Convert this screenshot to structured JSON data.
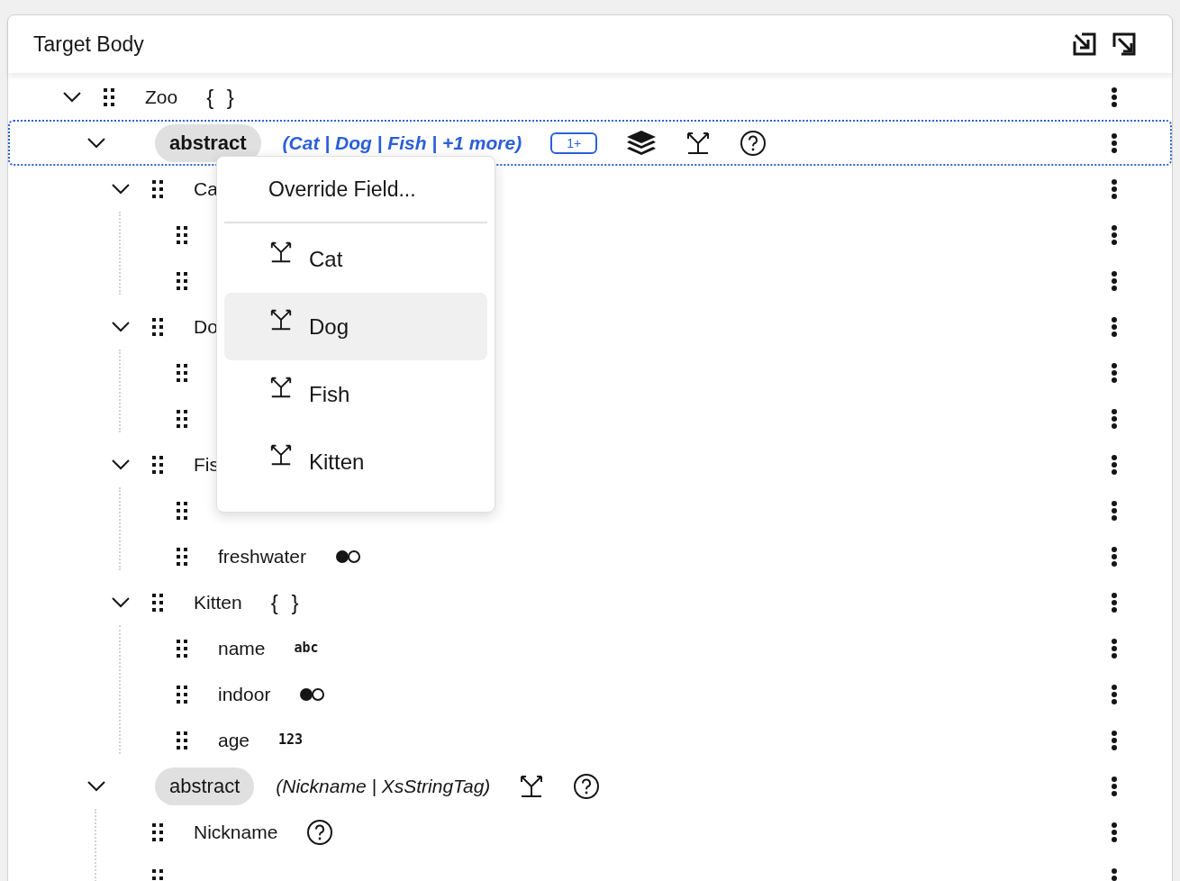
{
  "panel": {
    "title": "Target Body"
  },
  "tree": [
    {
      "kind": "object",
      "label": "Zoo",
      "type_badge": "{ }",
      "expanded": true,
      "children": [
        {
          "kind": "abstract",
          "label": "abstract",
          "types": "(Cat | Dog | Fish | +1 more)",
          "count_badge": "1+",
          "layers_button": true,
          "override_button": true,
          "help_button": true,
          "expanded": true,
          "selected": true,
          "children": [
            {
              "kind": "object",
              "label": "Ca",
              "expanded": true,
              "children": [
                {
                  "kind": "field"
                },
                {
                  "kind": "field"
                }
              ]
            },
            {
              "kind": "object",
              "label": "Do",
              "expanded": true,
              "children": [
                {
                  "kind": "field"
                },
                {
                  "kind": "field"
                }
              ]
            },
            {
              "kind": "object",
              "label": "Fis",
              "expanded": true,
              "children": [
                {
                  "kind": "field"
                },
                {
                  "kind": "boolean_field",
                  "label": "freshwater"
                }
              ]
            },
            {
              "kind": "object",
              "label": "Kitten",
              "type_badge": "{ }",
              "expanded": true,
              "children": [
                {
                  "kind": "field",
                  "label": "name",
                  "type_badge": "abc"
                },
                {
                  "kind": "boolean_field",
                  "label": "indoor"
                },
                {
                  "kind": "field",
                  "label": "age",
                  "type_badge": "123"
                }
              ]
            }
          ]
        },
        {
          "kind": "abstract",
          "label": "abstract",
          "types": "(Nickname | XsStringTag)",
          "layers_button": false,
          "override_button": true,
          "help_button": true,
          "expanded": true,
          "selected": false,
          "children": [
            {
              "kind": "field",
              "label": "Nickname",
              "help_button": true
            },
            {
              "kind": "field"
            }
          ]
        }
      ]
    }
  ],
  "menu": {
    "header": "Override Field...",
    "items": [
      {
        "label": "Cat",
        "selected": false
      },
      {
        "label": "Dog",
        "selected": true
      },
      {
        "label": "Fish",
        "selected": false
      },
      {
        "label": "Kitten",
        "selected": false
      }
    ]
  }
}
